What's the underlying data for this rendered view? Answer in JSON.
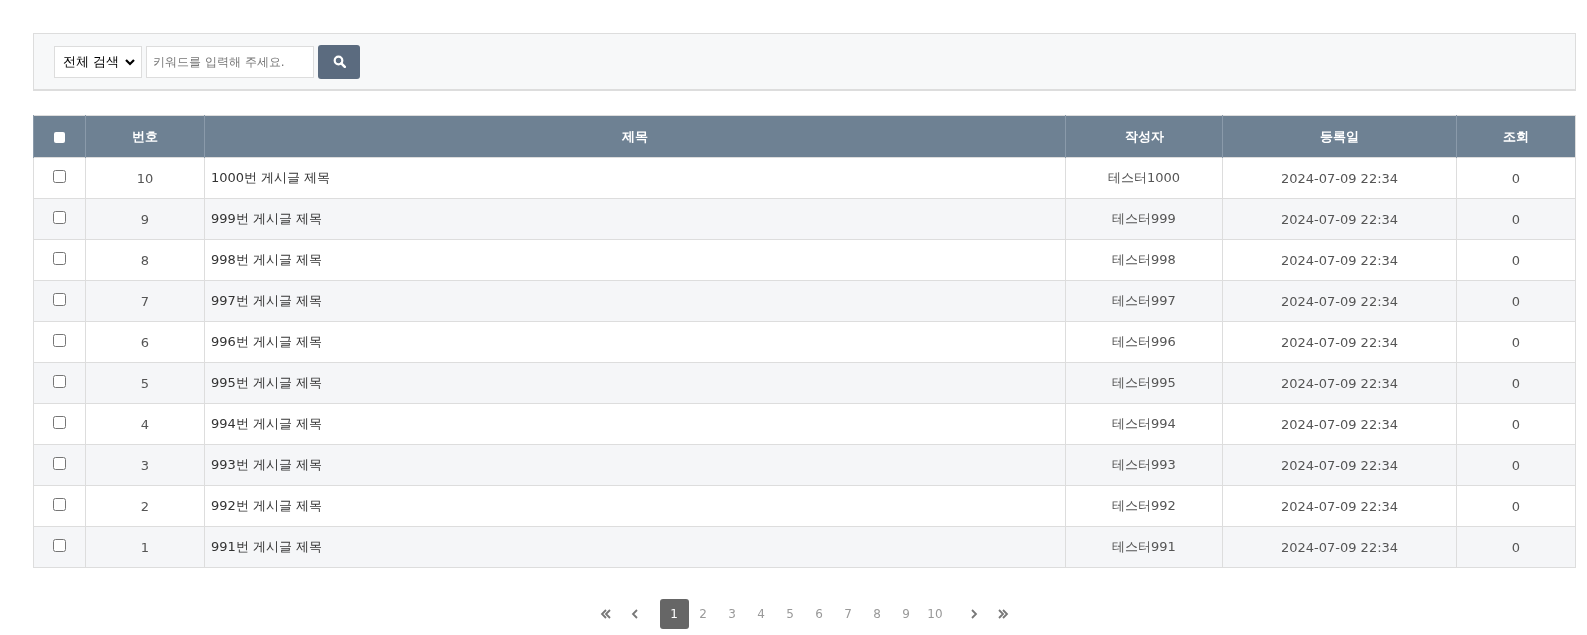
{
  "search": {
    "scope": "전체 검색",
    "placeholder": "키워드를 입력해 주세요."
  },
  "table": {
    "select_all_checked": false,
    "columns": [
      "번호",
      "제목",
      "작성자",
      "등록일",
      "조회"
    ],
    "rows": [
      {
        "checked": false,
        "number": "10",
        "title": "1000번 게시글 제목",
        "author": "테스터1000",
        "date": "2024-07-09 22:34",
        "views": "0"
      },
      {
        "checked": false,
        "number": "9",
        "title": "999번 게시글 제목",
        "author": "테스터999",
        "date": "2024-07-09 22:34",
        "views": "0"
      },
      {
        "checked": false,
        "number": "8",
        "title": "998번 게시글 제목",
        "author": "테스터998",
        "date": "2024-07-09 22:34",
        "views": "0"
      },
      {
        "checked": false,
        "number": "7",
        "title": "997번 게시글 제목",
        "author": "테스터997",
        "date": "2024-07-09 22:34",
        "views": "0"
      },
      {
        "checked": false,
        "number": "6",
        "title": "996번 게시글 제목",
        "author": "테스터996",
        "date": "2024-07-09 22:34",
        "views": "0"
      },
      {
        "checked": false,
        "number": "5",
        "title": "995번 게시글 제목",
        "author": "테스터995",
        "date": "2024-07-09 22:34",
        "views": "0"
      },
      {
        "checked": false,
        "number": "4",
        "title": "994번 게시글 제목",
        "author": "테스터994",
        "date": "2024-07-09 22:34",
        "views": "0"
      },
      {
        "checked": false,
        "number": "3",
        "title": "993번 게시글 제목",
        "author": "테스터993",
        "date": "2024-07-09 22:34",
        "views": "0"
      },
      {
        "checked": false,
        "number": "2",
        "title": "992번 게시글 제목",
        "author": "테스터992",
        "date": "2024-07-09 22:34",
        "views": "0"
      },
      {
        "checked": false,
        "number": "1",
        "title": "991번 게시글 제목",
        "author": "테스터991",
        "date": "2024-07-09 22:34",
        "views": "0"
      }
    ]
  },
  "pagination": {
    "pages": [
      {
        "label": "1",
        "selected": true
      },
      {
        "label": "2",
        "selected": false
      },
      {
        "label": "3",
        "selected": false
      },
      {
        "label": "4",
        "selected": false
      },
      {
        "label": "5",
        "selected": false
      },
      {
        "label": "6",
        "selected": false
      },
      {
        "label": "7",
        "selected": false
      },
      {
        "label": "8",
        "selected": false
      },
      {
        "label": "9",
        "selected": false
      },
      {
        "label": "10",
        "selected": false
      }
    ]
  }
}
